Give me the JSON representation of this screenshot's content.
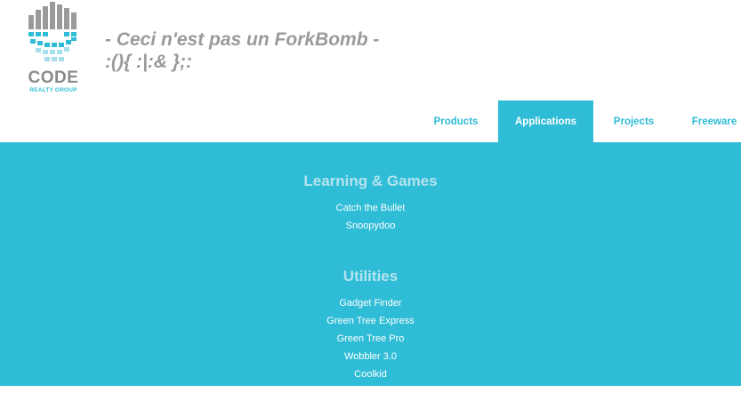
{
  "logo": {
    "name": "CODE",
    "subtitle": "REALTY GROUP"
  },
  "tagline": {
    "line1": "- Ceci n'est pas un ForkBomb -",
    "line2": ":(){ :|:& };:"
  },
  "nav": {
    "items": [
      {
        "label": "Products"
      },
      {
        "label": "Applications",
        "active": true
      },
      {
        "label": "Projects"
      },
      {
        "label": "Freeware"
      }
    ]
  },
  "sections": [
    {
      "title": "Learning & Games",
      "links": [
        "Catch the Bullet",
        "Snoopydoo"
      ]
    },
    {
      "title": "Utilities",
      "links": [
        "Gadget Finder",
        "Green Tree Express",
        "Green Tree Pro",
        "Wobbler 3.0",
        "Coolkid"
      ]
    }
  ],
  "colors": {
    "accent": "#2ebcd6",
    "section_title": "#b5e4ef",
    "logo_gray": "#8a8a8a",
    "tagline": "#9a9a9a"
  }
}
